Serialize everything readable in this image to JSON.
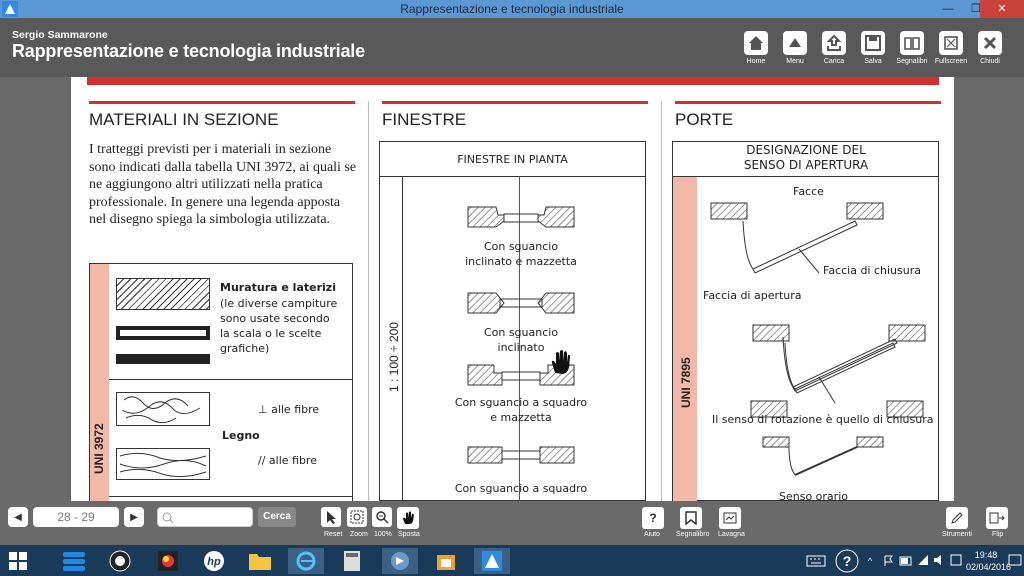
{
  "window": {
    "title": "Rappresentazione e tecnologia industriale"
  },
  "header": {
    "author": "Sergio Sammarone",
    "title": "Rappresentazione e tecnologia industriale"
  },
  "toolbar": [
    {
      "label": "Home",
      "icon": "home-icon"
    },
    {
      "label": "Menu",
      "icon": "menu-icon"
    },
    {
      "label": "Carica",
      "icon": "upload-icon"
    },
    {
      "label": "Salva",
      "icon": "save-icon"
    },
    {
      "label": "Segnalibri",
      "icon": "bookmarks-icon"
    },
    {
      "label": "Fullscreen",
      "icon": "fullscreen-icon"
    },
    {
      "label": "Chiudi",
      "icon": "close-icon"
    }
  ],
  "page": {
    "col1": {
      "heading": "MATERIALI IN SEZIONE",
      "text": "I tratteggi previsti per i materiali in sezione sono indicati dalla tabella UNI 3972, ai quali se ne aggiungono altri utilizzati nella pratica professionale. In genere una legenda apposta nel disegno spiega la simbologia utilizzata.",
      "table_label": "UNI 3972",
      "muratura_title": "Muratura e laterizi",
      "muratura_desc": "(le diverse campiture sono usate secondo la scala o le scelte grafiche)",
      "legno": "Legno",
      "fibre_perp": "⊥ alle fibre",
      "fibre_par": "// alle fibre"
    },
    "col2": {
      "heading": "FINESTRE",
      "box_title": "FINESTRE IN PIANTA",
      "scale": "1 : 100 ÷ 200",
      "items": [
        "Con sguancio inclinato e mazzetta",
        "Con sguancio inclinato",
        "Con sguancio a squadro e mazzetta",
        "Con sguancio a squadro"
      ]
    },
    "col3": {
      "heading": "PORTE",
      "box_title": "DESIGNAZIONE DEL SENSO DI APERTURA",
      "table_label": "UNI 7895",
      "facce": "Facce",
      "chiusura": "Faccia di chiusura",
      "apertura": "Faccia di apertura",
      "rotazione": "Il senso di rotazione è quello di chiusura",
      "orario": "Senso orario"
    }
  },
  "bottom": {
    "page_indicator": "28 - 29",
    "search_placeholder": "",
    "search_button": "Cerca",
    "tools": [
      "Reset",
      "Zoom",
      "100%",
      "Sposta"
    ],
    "right": [
      "Aiuto",
      "Segnalibro",
      "Lavagna"
    ],
    "far": [
      "Strumenti",
      "Flip"
    ]
  },
  "taskbar": {
    "time": "19:48",
    "date": "02/04/2016"
  }
}
